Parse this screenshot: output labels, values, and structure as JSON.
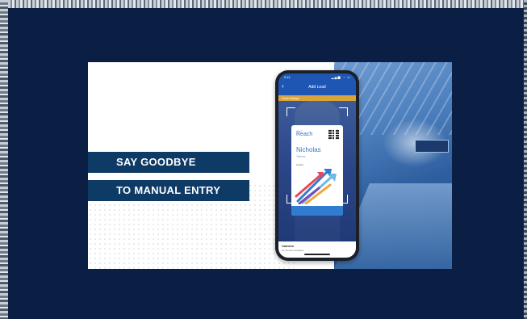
{
  "banners": [
    "SAY GOODBYE",
    "TO MANUAL ENTRY"
  ],
  "phone": {
    "status_time": "9:41",
    "status_icons": "▂▄▆ ◔ ▭",
    "nav_title": "Add Lead",
    "gold_bar_text": "Scan Badge",
    "badge": {
      "brand_small": "event",
      "brand": "Reach",
      "first_name": "Nicholas",
      "last_name": "Yellow",
      "org": "Coach"
    },
    "sheet_title": "Camera",
    "sheet_subtitle": "No Results Available"
  },
  "colors": {
    "frame": "#0b1f45",
    "banner": "#0e3a66",
    "phone_header": "#1e57b3",
    "gold": "#d9a43a",
    "badge_blue": "#2f7dd0"
  }
}
